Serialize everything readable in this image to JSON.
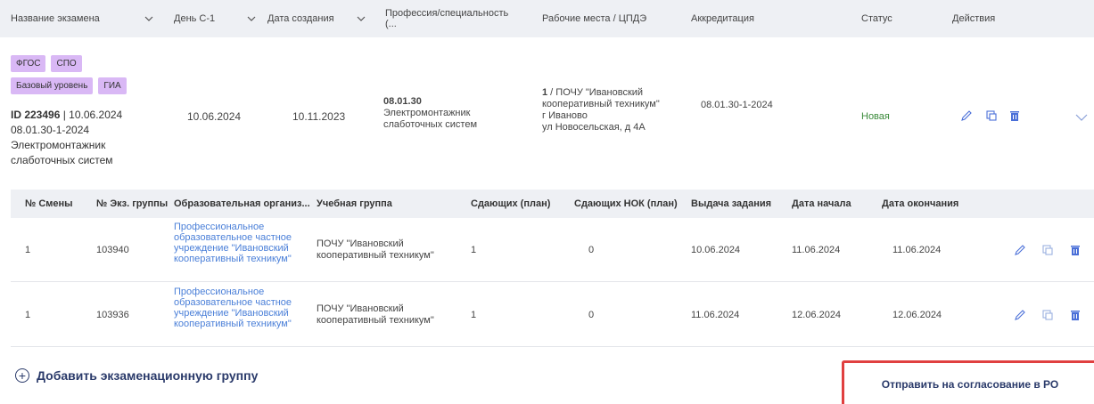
{
  "header": {
    "exam_name": "Название экзамена",
    "day_c1": "День С-1",
    "created": "Дата создания",
    "profession": "Профессия/специальность (...",
    "workplaces": "Рабочие места / ЦПДЭ",
    "accreditation": "Аккредитация",
    "status": "Статус",
    "actions": "Действия"
  },
  "exam": {
    "badges_row1": [
      "ФГОС",
      "СПО"
    ],
    "badges_row2": [
      "Базовый уровень",
      "ГИА"
    ],
    "id_label": "ID 223496",
    "id_date": " | 10.06.2024",
    "code": "08.01.30-1-2024",
    "name_line1": "Электромонтажник",
    "name_line2": "слаботочных систем",
    "day_c1": "10.06.2024",
    "created": "10.11.2023",
    "profession_code": "08.01.30",
    "profession_line1": "Электромонтажник",
    "profession_line2": "слаботочных систем",
    "workplace_num": "1",
    "workplace_line1": " / ПОЧУ \"Ивановский",
    "workplace_line2": "кооперативный техникум\"",
    "workplace_line3": "г Иваново",
    "workplace_line4": "ул Новосельская, д 4А",
    "accreditation": "08.01.30-1-2024",
    "status": "Новая",
    "icons": [
      "pencil-icon",
      "copy-icon",
      "trash-icon",
      "chevron-down-icon"
    ]
  },
  "groups_header": {
    "shift": "№ Смены",
    "exam_group": "№ Экз. группы",
    "org": "Образовательная организ...",
    "study_group": "Учебная группа",
    "planned": "Сдающих (план)",
    "planned_nok": "Сдающих НОК (план)",
    "issue": "Выдача задания",
    "start": "Дата начала",
    "end": "Дата окончания"
  },
  "groups": [
    {
      "shift": "1",
      "exam_group": "103940",
      "org_line1": "Профессиональное",
      "org_line2": "образовательное частное",
      "org_line3": "учреждение \"Ивановский",
      "org_line4": "кооперативный техникум\"",
      "study_line1": "ПОЧУ \"Ивановский",
      "study_line2": "кооперативный техникум\"",
      "planned": "1",
      "planned_nok": "0",
      "issue": "10.06.2024",
      "start": "11.06.2024",
      "end": "11.06.2024"
    },
    {
      "shift": "1",
      "exam_group": "103936",
      "org_line1": "Профессиональное",
      "org_line2": "образовательное частное",
      "org_line3": "учреждение \"Ивановский",
      "org_line4": "кооперативный техникум\"",
      "study_line1": "ПОЧУ \"Ивановский",
      "study_line2": "кооперативный техникум\"",
      "planned": "1",
      "planned_nok": "0",
      "issue": "11.06.2024",
      "start": "12.06.2024",
      "end": "12.06.2024"
    }
  ],
  "add_group_label": "Добавить экзаменационную группу",
  "send_label": "Отправить на согласование в РО",
  "colors": {
    "header_bg": "#eef0f4",
    "badge": "#d9b8f5",
    "link": "#4a7fd8",
    "status_new": "#3a8a3a",
    "accent_dark": "#2a3a6a",
    "highlight": "#e04040",
    "icon_blue": "#4a6fd8"
  }
}
